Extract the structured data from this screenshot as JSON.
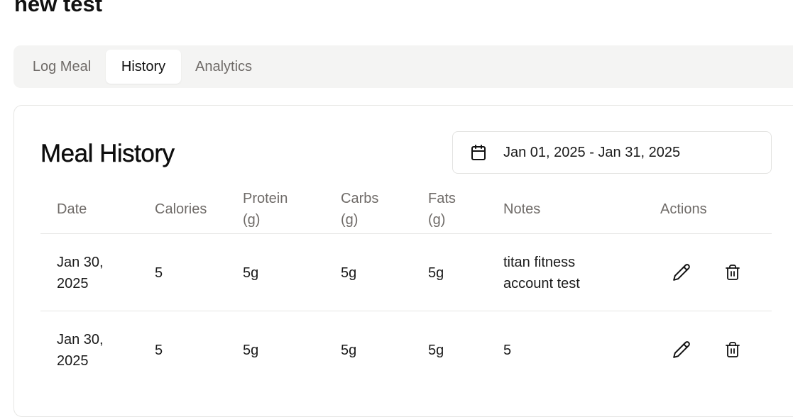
{
  "page": {
    "title": "new test"
  },
  "tabs": [
    {
      "label": "Log Meal",
      "active": false
    },
    {
      "label": "History",
      "active": true
    },
    {
      "label": "Analytics",
      "active": false
    }
  ],
  "history": {
    "title": "Meal History",
    "date_range": "Jan 01, 2025 - Jan 31, 2025",
    "columns": {
      "date": "Date",
      "calories": "Calories",
      "protein_1": "Protein",
      "protein_2": "(g)",
      "carbs_1": "Carbs",
      "carbs_2": "(g)",
      "fats_1": "Fats",
      "fats_2": "(g)",
      "notes": "Notes",
      "actions": "Actions"
    },
    "rows": [
      {
        "date_1": "Jan 30,",
        "date_2": "2025",
        "calories": "5",
        "protein": "5g",
        "carbs": "5g",
        "fats": "5g",
        "notes_1": "titan fitness",
        "notes_2": "account test"
      },
      {
        "date_1": "Jan 30,",
        "date_2": "2025",
        "calories": "5",
        "protein": "5g",
        "carbs": "5g",
        "fats": "5g",
        "notes_1": "5",
        "notes_2": ""
      }
    ]
  },
  "icons": {
    "calendar": "calendar-icon",
    "edit": "pencil-icon",
    "delete": "trash-icon"
  }
}
